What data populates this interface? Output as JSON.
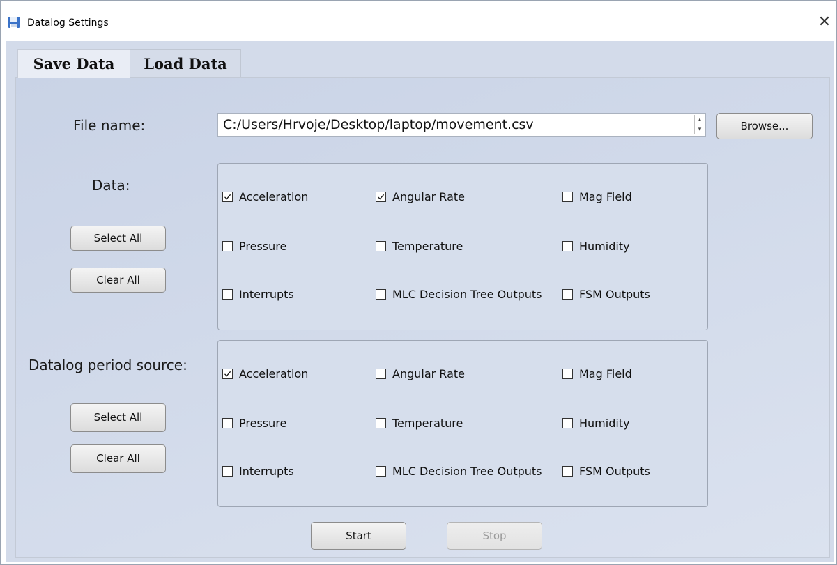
{
  "window": {
    "title": "Datalog Settings",
    "close_glyph": "✕"
  },
  "tabs": [
    {
      "label": "Save Data",
      "active": true
    },
    {
      "label": "Load Data",
      "active": false
    }
  ],
  "file": {
    "label": "File name:",
    "value": "C:/Users/Hrvoje/Desktop/laptop/movement.csv",
    "browse_label": "Browse..."
  },
  "data_section": {
    "label": "Data:",
    "select_all_label": "Select All",
    "clear_all_label": "Clear All",
    "items": [
      {
        "label": "Acceleration",
        "checked": true
      },
      {
        "label": "Angular Rate",
        "checked": true
      },
      {
        "label": "Mag Field",
        "checked": false
      },
      {
        "label": "Pressure",
        "checked": false
      },
      {
        "label": "Temperature",
        "checked": false
      },
      {
        "label": "Humidity",
        "checked": false
      },
      {
        "label": "Interrupts",
        "checked": false
      },
      {
        "label": "MLC Decision Tree Outputs",
        "checked": false
      },
      {
        "label": "FSM Outputs",
        "checked": false
      }
    ]
  },
  "period_section": {
    "label": "Datalog period source:",
    "select_all_label": "Select All",
    "clear_all_label": "Clear All",
    "items": [
      {
        "label": "Acceleration",
        "checked": true
      },
      {
        "label": "Angular Rate",
        "checked": false
      },
      {
        "label": "Mag Field",
        "checked": false
      },
      {
        "label": "Pressure",
        "checked": false
      },
      {
        "label": "Temperature",
        "checked": false
      },
      {
        "label": "Humidity",
        "checked": false
      },
      {
        "label": "Interrupts",
        "checked": false
      },
      {
        "label": "MLC Decision Tree Outputs",
        "checked": false
      },
      {
        "label": "FSM Outputs",
        "checked": false
      }
    ]
  },
  "actions": {
    "start_label": "Start",
    "stop_label": "Stop",
    "stop_enabled": false
  }
}
